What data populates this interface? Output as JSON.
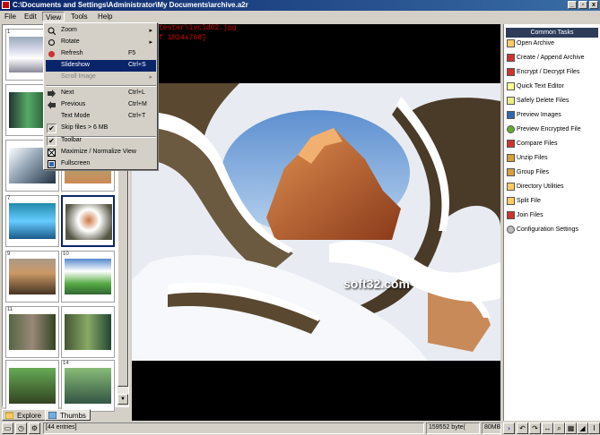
{
  "window": {
    "title": "C:\\Documents and Settings\\Administrator\\My Documents\\archive.a2r"
  },
  "menubar": [
    "File",
    "Edit",
    "View",
    "Tools",
    "Help"
  ],
  "view_menu": {
    "items": [
      {
        "label": "Zoom",
        "shortcut": "",
        "submenu": true,
        "icon": "zoom-icon"
      },
      {
        "label": "Rotate",
        "shortcut": "",
        "submenu": true,
        "icon": "rotate-icon"
      },
      {
        "label": "Refresh",
        "shortcut": "F5",
        "icon": "refresh-icon"
      },
      {
        "label": "Slideshow",
        "shortcut": "Ctrl+S",
        "highlighted": true
      },
      {
        "label": "Scroll Image",
        "shortcut": "",
        "submenu": true,
        "disabled": true
      },
      {
        "label": "Next",
        "shortcut": "Ctrl+L",
        "icon": "next-arrow-icon"
      },
      {
        "label": "Previous",
        "shortcut": "Ctrl+M",
        "icon": "previous-arrow-icon"
      },
      {
        "label": "Text Mode",
        "shortcut": "Ctrl+T"
      },
      {
        "label": "Skip files > 6 MB",
        "shortcut": "",
        "checked": true
      },
      {
        "label": "Toolbar",
        "shortcut": "",
        "checked": true
      },
      {
        "label": "Maximize / Normalize View",
        "shortcut": ""
      },
      {
        "label": "Fullscreen",
        "shortcut": ""
      }
    ]
  },
  "viewer": {
    "path_line1": "tester\\ivcld02.jpg",
    "path_line2": "f 1024x768]",
    "watermark": "soft32.com"
  },
  "thumbnails": [
    {
      "num": "1"
    },
    {
      "num": ""
    },
    {
      "num": ""
    },
    {
      "num": ""
    },
    {
      "num": ""
    },
    {
      "num": ""
    },
    {
      "num": "7"
    },
    {
      "num": ""
    },
    {
      "num": "9"
    },
    {
      "num": "10"
    },
    {
      "num": "11"
    },
    {
      "num": ""
    },
    {
      "num": ""
    },
    {
      "num": "14"
    }
  ],
  "tabs": [
    {
      "label": "Explore"
    },
    {
      "label": "Thumbs"
    }
  ],
  "tasks": {
    "title": "Common Tasks",
    "items": [
      "Open Archive",
      "Create / Append Archive",
      "Encrypt / Decrypt Files",
      "Quick Text Editor",
      "Safely Delete Files",
      "Preview Images",
      "Preview Encrypted File",
      "Compare Files",
      "Unzip Files",
      "Group Files",
      "Directory Utilities",
      "Split File",
      "Join Files",
      "Configuration Settings"
    ]
  },
  "status": {
    "entries": "[44 entries]",
    "bytes": "159552 byte(",
    "memory": "80MB"
  }
}
